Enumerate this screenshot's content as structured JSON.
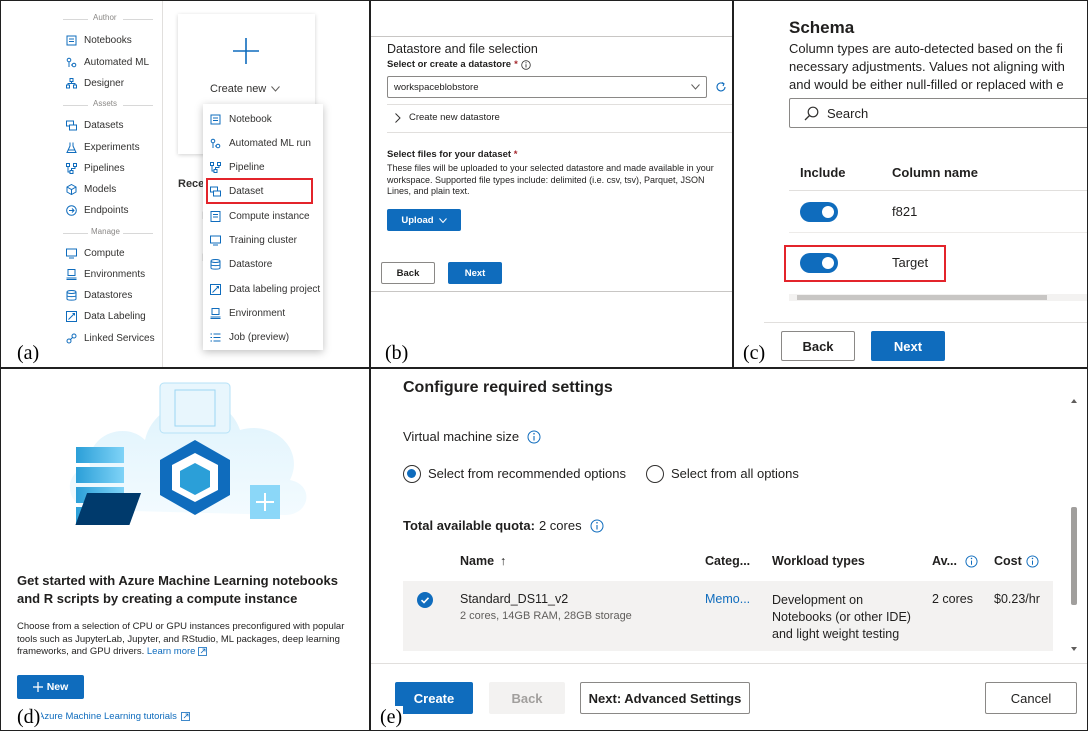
{
  "labels": {
    "a": "(a)",
    "b": "(b)",
    "c": "(c)",
    "d": "(d)",
    "e": "(e)"
  },
  "panel_a": {
    "sections": {
      "author": "Author",
      "assets": "Assets",
      "manage": "Manage"
    },
    "nav": {
      "notebooks": "Notebooks",
      "automated_ml": "Automated ML",
      "designer": "Designer",
      "datasets": "Datasets",
      "experiments": "Experiments",
      "pipelines": "Pipelines",
      "models": "Models",
      "endpoints": "Endpoints",
      "compute": "Compute",
      "environments": "Environments",
      "datastores": "Datastores",
      "data_labeling": "Data Labeling",
      "linked_services": "Linked Services"
    },
    "create_new": "Create new",
    "recent_fragment": "Recen",
    "fragment_r": "R",
    "fragment_d": "D",
    "menu": {
      "notebook": "Notebook",
      "automl_run": "Automated ML run",
      "pipeline": "Pipeline",
      "dataset": "Dataset",
      "compute_instance": "Compute instance",
      "training_cluster": "Training cluster",
      "datastore": "Datastore",
      "data_labeling_project": "Data labeling project",
      "environment": "Environment",
      "job_preview": "Job (preview)"
    }
  },
  "panel_b": {
    "title": "Datastore and file selection",
    "select_label": "Select or create a datastore",
    "required_mark": "*",
    "datastore_value": "workspaceblobstore",
    "create_datastore": "Create new datastore",
    "files_label": "Select files for your dataset",
    "description": "These files will be uploaded to your selected datastore and made available in your workspace. Supported file types include: delimited (i.e. csv, tsv), Parquet, JSON Lines, and plain text.",
    "upload": "Upload",
    "back": "Back",
    "next": "Next"
  },
  "panel_c": {
    "title": "Schema",
    "desc_line1": "Column types are auto-detected based on the fi",
    "desc_line2": "necessary adjustments. Values not aligning with",
    "desc_line3": "and would be either null-filled or replaced with e",
    "search_placeholder": "Search",
    "col_include": "Include",
    "col_name": "Column name",
    "row1": "f821",
    "row2": "Target",
    "back": "Back",
    "next": "Next"
  },
  "panel_d": {
    "heading": "Get started with Azure Machine Learning notebooks and R scripts by creating a compute instance",
    "body": "Choose from a selection of CPU or GPU instances preconfigured with popular tools such as JupyterLab, Jupyter, and RStudio, ML packages, deep learning frameworks, and GPU drivers.",
    "learn_more": "Learn more",
    "new_button": "New",
    "tutorials": "Azure Machine Learning tutorials"
  },
  "panel_e": {
    "title": "Configure required settings",
    "vm_size": "Virtual machine size",
    "opt_recommended": "Select from recommended options",
    "opt_all": "Select from all options",
    "quota_label": "Total available quota:",
    "quota_value": "2 cores",
    "headers": {
      "name": "Name",
      "sort_arrow": "↑",
      "category": "Categ...",
      "workload": "Workload types",
      "available": "Av...",
      "cost": "Cost"
    },
    "row": {
      "name": "Standard_DS11_v2",
      "specs": "2 cores, 14GB RAM, 28GB storage",
      "category": "Memo...",
      "workload1": "Development on",
      "workload2": "Notebooks (or other IDE)",
      "workload3": "and light weight testing",
      "available": "2 cores",
      "cost": "$0.23/hr"
    },
    "create": "Create",
    "back": "Back",
    "next_advanced": "Next: Advanced Settings",
    "cancel": "Cancel"
  },
  "colors": {
    "accent": "#0f6cbd",
    "highlight": "#e3242b"
  }
}
